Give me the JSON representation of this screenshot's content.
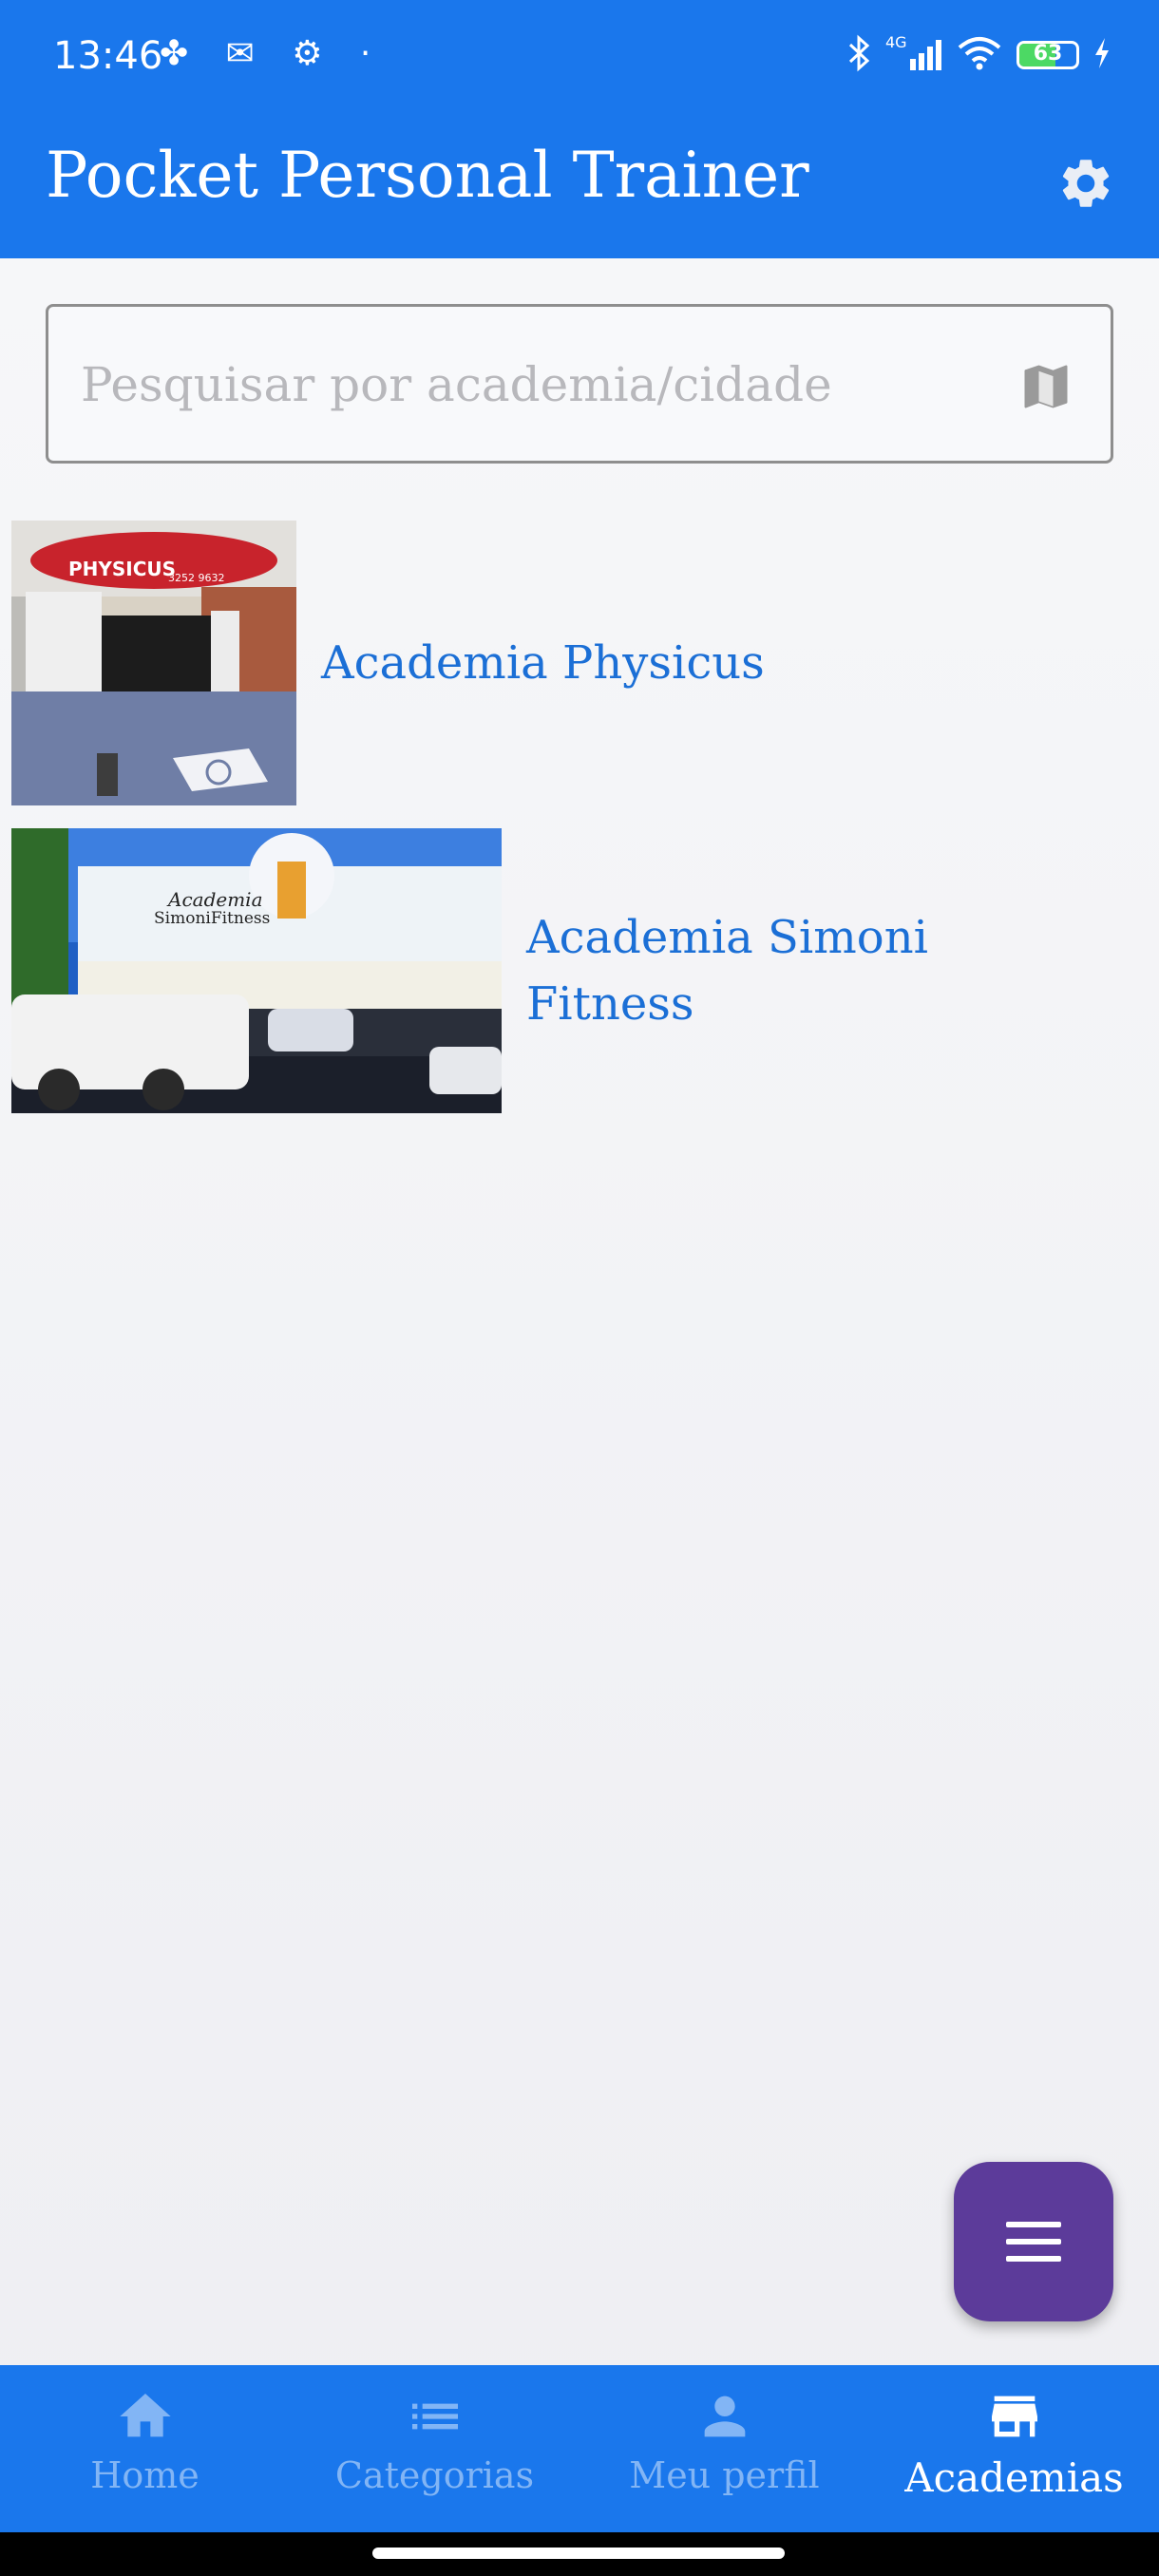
{
  "status_bar": {
    "time": "13:46",
    "battery": "63",
    "network": "4G"
  },
  "app_bar": {
    "title": "Pocket Personal Trainer"
  },
  "search": {
    "placeholder": "Pesquisar por academia/cidade",
    "value": ""
  },
  "gyms": [
    {
      "name": "Academia Physicus",
      "sign_text": "PHYSICUS",
      "phone": "3252 9632"
    },
    {
      "name_line1": "Academia Simoni",
      "name_line2": "Fitness",
      "sign_line1": "Academia",
      "sign_line2": "SimoniFitness"
    }
  ],
  "bottom_nav": {
    "items": [
      {
        "label": "Home",
        "icon": "home-icon"
      },
      {
        "label": "Categorias",
        "icon": "list-icon"
      },
      {
        "label": "Meu perfil",
        "icon": "person-icon"
      },
      {
        "label": "Academias",
        "icon": "store-icon",
        "active": true
      }
    ]
  },
  "colors": {
    "primary": "#1a77ec",
    "fab": "#5c3b9a",
    "link_text": "#1b6fd6"
  }
}
